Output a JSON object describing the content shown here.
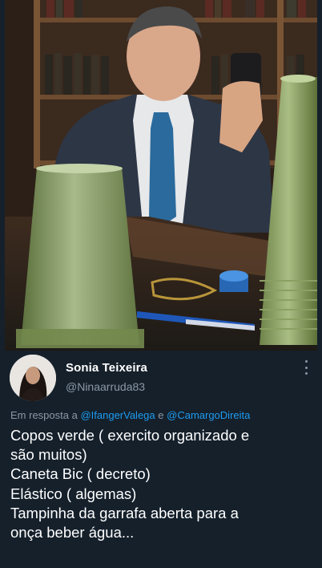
{
  "tweet": {
    "display_name": "Sonia Teixeira",
    "handle": "@Ninaarruda83",
    "reply_prefix": "Em resposta a",
    "reply_mention_1": "@IfangerValega",
    "reply_conjunction": "e",
    "reply_mention_2": "@CamargoDireita",
    "text_lines": [
      "Copos verde ( exercito organizado e",
      "são muitos)",
      "Caneta Bic ( decreto)",
      "Elástico ( algemas)",
      "Tampinha da garrafa aberta para a",
      "onça beber água..."
    ]
  },
  "icons": {
    "more": "more-options-icon",
    "avatar": "profile-photo"
  },
  "colors": {
    "background": "#15202b",
    "text": "#ffffff",
    "secondary_text": "#8b98a5",
    "link": "#1d9bf0"
  }
}
